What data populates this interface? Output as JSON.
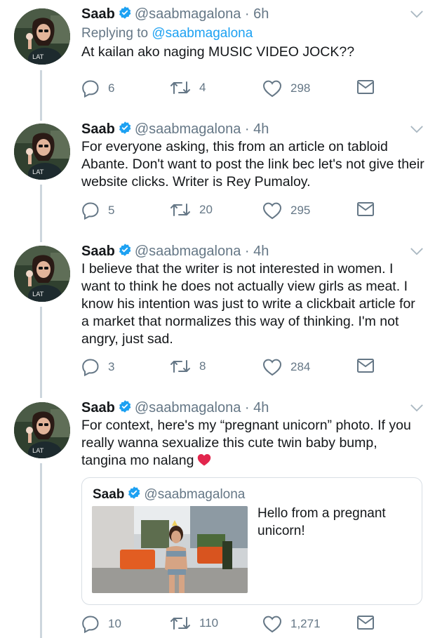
{
  "tweets": [
    {
      "name": "Saab",
      "handle": "@saabmagalona",
      "time": "· 6h",
      "reply_prefix": "Replying to",
      "reply_handle": "@saabmagalona",
      "text": "At kailan ako naging MUSIC VIDEO JOCK??",
      "replies": "6",
      "retweets": "4",
      "likes": "298"
    },
    {
      "name": "Saab",
      "handle": "@saabmagalona",
      "time": "· 4h",
      "text": "For everyone asking, this from an article on tabloid Abante. Don't want to post the link bec let's not give their website clicks. Writer is Rey Pumaloy.",
      "replies": "5",
      "retweets": "20",
      "likes": "295"
    },
    {
      "name": "Saab",
      "handle": "@saabmagalona",
      "time": "· 4h",
      "text": "I believe that the writer is not interested in women. I want to think he does not actually view girls as meat. I know his intention was just to write a clickbait article for a market that normalizes this way of thinking. I'm not angry, just sad.",
      "replies": "3",
      "retweets": "8",
      "likes": "284"
    },
    {
      "name": "Saab",
      "handle": "@saabmagalona",
      "time": "· 4h",
      "text": "For context, here's my “pregnant unicorn” photo. If you really wanna sexualize this cute twin baby bump, tangina mo nalang",
      "replies": "10",
      "retweets": "110",
      "likes": "1,271",
      "quote": {
        "name": "Saab",
        "handle": "@saabmagalona",
        "text": "Hello from a pregnant unicorn!"
      }
    }
  ],
  "icons": {
    "verified": "verified-badge-icon",
    "reply": "reply-icon",
    "retweet": "retweet-icon",
    "like": "heart-icon",
    "dm": "envelope-icon",
    "more": "chevron-down-icon",
    "emoji": "red-heart-emoji"
  },
  "colors": {
    "verified": "#1da1f2",
    "link": "#1da1f2",
    "secondary_text": "#657786",
    "thread_line": "#cdd6dd",
    "emoji_heart": "#e2264d"
  }
}
